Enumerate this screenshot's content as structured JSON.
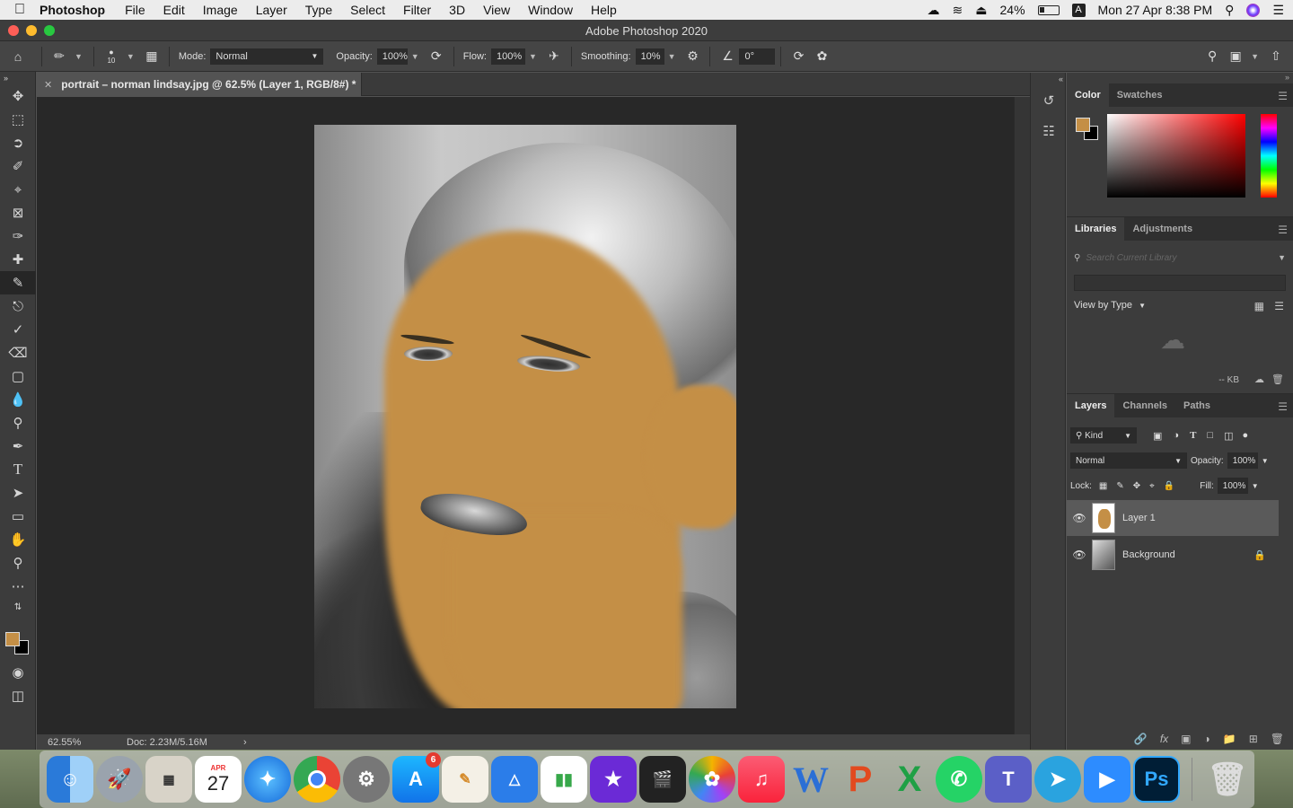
{
  "menubar": {
    "app_name": "Photoshop",
    "items": [
      "File",
      "Edit",
      "Image",
      "Layer",
      "Type",
      "Select",
      "Filter",
      "3D",
      "View",
      "Window",
      "Help"
    ],
    "battery": "24%",
    "input_source": "A",
    "clock": "Mon 27 Apr  8:38 PM"
  },
  "window": {
    "title": "Adobe Photoshop 2020"
  },
  "options": {
    "brush_size": "10",
    "mode_label": "Mode:",
    "mode_value": "Normal",
    "opacity_label": "Opacity:",
    "opacity_value": "100%",
    "flow_label": "Flow:",
    "flow_value": "100%",
    "smoothing_label": "Smoothing:",
    "smoothing_value": "10%",
    "angle_value": "0°"
  },
  "document": {
    "tab_title": "portrait – norman lindsay.jpg @ 62.5% (Layer 1, RGB/8#) *",
    "zoom": "62.55%",
    "doc_size": "Doc: 2.23M/5.16M"
  },
  "colors": {
    "foreground": "#c48f46",
    "background": "#000000"
  },
  "panels": {
    "color_tabs": [
      "Color",
      "Swatches"
    ],
    "library_tabs": [
      "Libraries",
      "Adjustments"
    ],
    "library_search_placeholder": "Search Current Library",
    "view_by": "View by Type",
    "library_size": "-- KB",
    "layer_tabs": [
      "Layers",
      "Channels",
      "Paths"
    ],
    "kind_filter": "Kind",
    "blend_mode": "Normal",
    "opacity_label": "Opacity:",
    "opacity_value": "100%",
    "lock_label": "Lock:",
    "fill_label": "Fill:",
    "fill_value": "100%",
    "layers": [
      {
        "name": "Layer 1",
        "selected": true
      },
      {
        "name": "Background",
        "selected": false,
        "locked": true
      }
    ]
  },
  "dock": {
    "calendar_month": "APR",
    "calendar_day": "27",
    "appstore_badge": "6",
    "photoshop_label": "Ps",
    "word_label": "W"
  }
}
